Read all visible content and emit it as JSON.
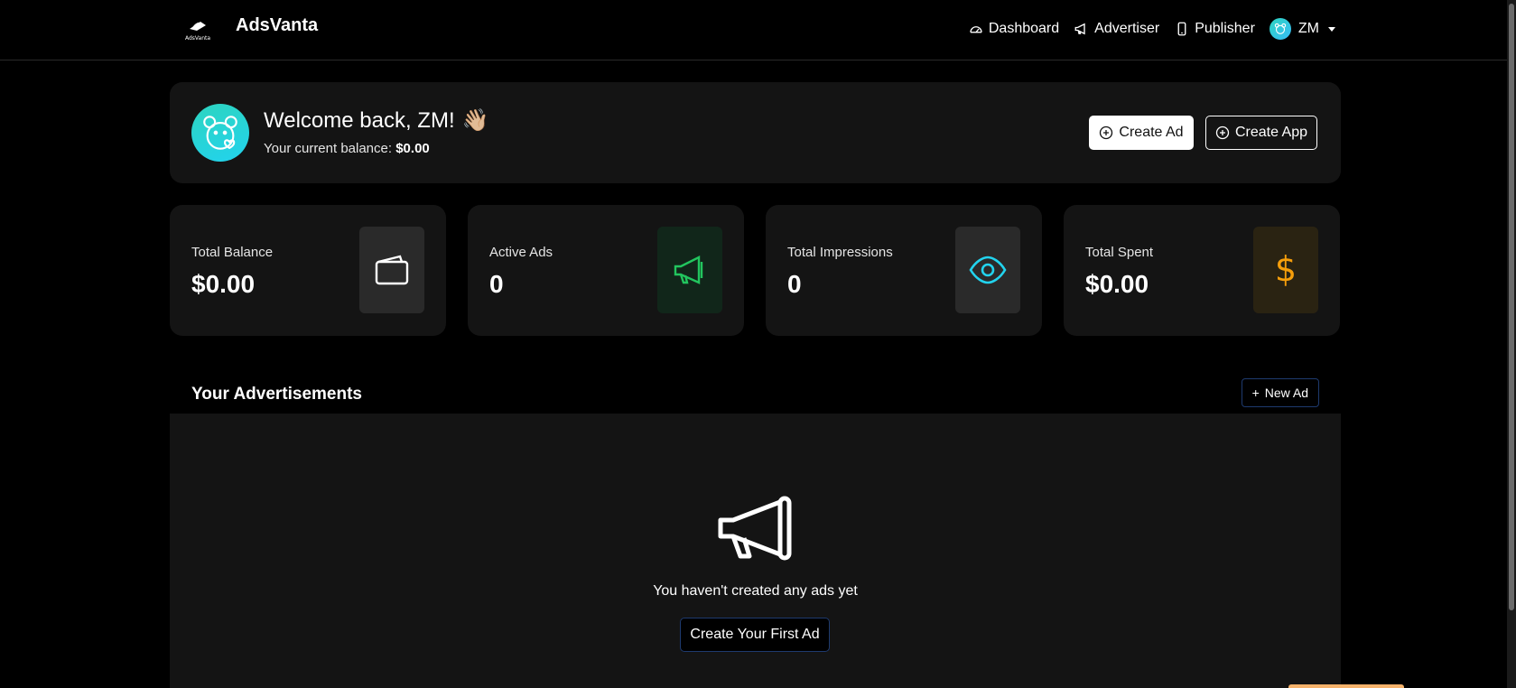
{
  "nav": {
    "brand_name": "AdsVanta",
    "logo_caption": "AdsVanta",
    "links": [
      {
        "label": "Dashboard",
        "icon": "speedometer-icon"
      },
      {
        "label": "Advertiser",
        "icon": "megaphone-icon"
      },
      {
        "label": "Publisher",
        "icon": "phone-icon"
      }
    ],
    "user_initials": "ZM"
  },
  "welcome": {
    "title": "Welcome back, ZM!",
    "emoji": "👋🏼",
    "balance_label": "Your current balance:",
    "balance_value": "$0.00",
    "create_ad_label": "Create Ad",
    "create_app_label": "Create App"
  },
  "stats": [
    {
      "label": "Total Balance",
      "value": "$0.00",
      "icon": "wallet-icon",
      "icon_color": "#ffffff",
      "icon_bg": "#2a2a2a"
    },
    {
      "label": "Active Ads",
      "value": "0",
      "icon": "megaphone-icon",
      "icon_color": "#22c55e",
      "icon_bg": "#11261a"
    },
    {
      "label": "Total Impressions",
      "value": "0",
      "icon": "eye-icon",
      "icon_color": "#22d3ee",
      "icon_bg": "#2a2a2a"
    },
    {
      "label": "Total Spent",
      "value": "$0.00",
      "icon": "dollar-icon",
      "icon_color": "#f59e0b",
      "icon_bg": "#2a2312"
    }
  ],
  "ads": {
    "title": "Your Advertisements",
    "new_ad_label": "New Ad",
    "empty_text": "You haven't created any ads yet",
    "first_ad_label": "Create Your First Ad"
  },
  "colors": {
    "background": "#000000",
    "card": "#141414",
    "accent_blue_border": "#1e3a6e",
    "avatar_teal": "#2dd4bf"
  }
}
